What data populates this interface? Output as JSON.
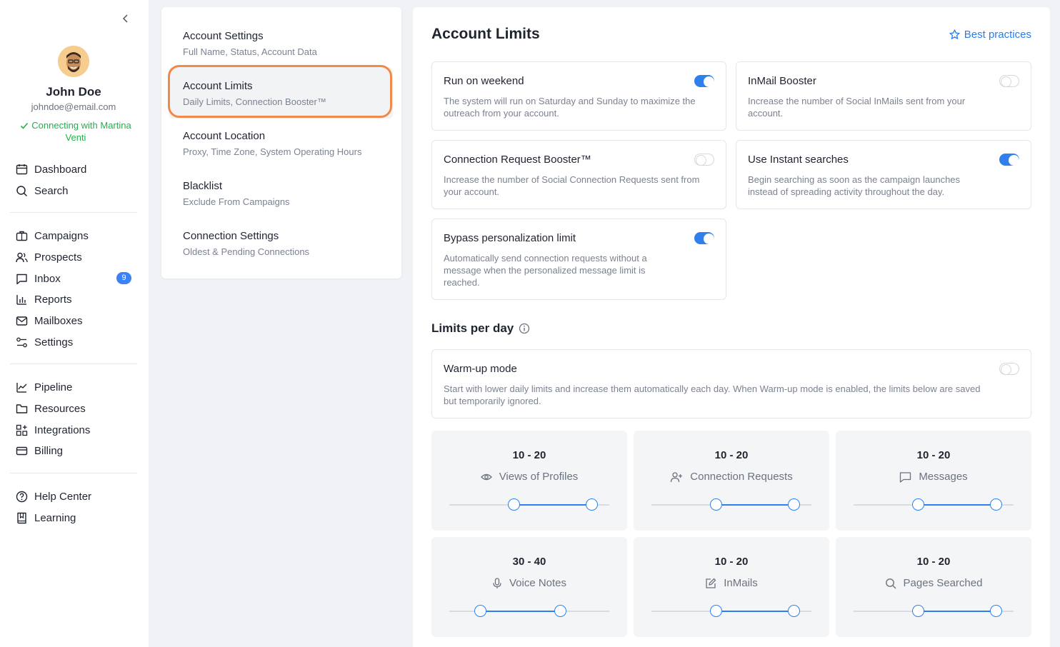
{
  "sidebar": {
    "user": {
      "name": "John Doe",
      "email": "johndoe@email.com",
      "status": "Connecting with Martina Venti"
    },
    "nav_group1": [
      {
        "label": "Dashboard",
        "icon": "calendar-icon"
      },
      {
        "label": "Search",
        "icon": "search-icon"
      }
    ],
    "nav_group2": [
      {
        "label": "Campaigns",
        "icon": "briefcase-icon"
      },
      {
        "label": "Prospects",
        "icon": "users-icon"
      },
      {
        "label": "Inbox",
        "icon": "chat-icon",
        "badge": "9"
      },
      {
        "label": "Reports",
        "icon": "bar-chart-icon"
      },
      {
        "label": "Mailboxes",
        "icon": "mail-icon"
      },
      {
        "label": "Settings",
        "icon": "sliders-icon"
      }
    ],
    "nav_group3": [
      {
        "label": "Pipeline",
        "icon": "line-chart-icon"
      },
      {
        "label": "Resources",
        "icon": "folder-icon"
      },
      {
        "label": "Integrations",
        "icon": "grid-plus-icon"
      },
      {
        "label": "Billing",
        "icon": "credit-card-icon"
      }
    ],
    "nav_group4": [
      {
        "label": "Help Center",
        "icon": "help-circle-icon"
      },
      {
        "label": "Learning",
        "icon": "book-icon"
      }
    ]
  },
  "settings_menu": [
    {
      "title": "Account Settings",
      "subtitle": "Full Name, Status, Account Data"
    },
    {
      "title": "Account Limits",
      "subtitle": "Daily Limits, Connection Booster™",
      "active": true
    },
    {
      "title": "Account Location",
      "subtitle": "Proxy, Time Zone, System Operating Hours"
    },
    {
      "title": "Blacklist",
      "subtitle": "Exclude From Campaigns"
    },
    {
      "title": "Connection Settings",
      "subtitle": "Oldest & Pending Connections"
    }
  ],
  "main": {
    "title": "Account Limits",
    "best_practices": "Best practices",
    "options": [
      {
        "title": "Run on weekend",
        "desc": "The system will run on Saturday and Sunday to maximize the outreach from your account.",
        "on": true
      },
      {
        "title": "InMail Booster",
        "desc": "Increase the number of Social InMails sent from your account.",
        "on": false
      },
      {
        "title": "Connection Request Booster™",
        "desc": "Increase the number of Social Connection Requests sent from your account.",
        "on": false
      },
      {
        "title": "Use Instant searches",
        "desc": "Begin searching as soon as the campaign launches instead of spreading activity throughout the day.",
        "on": true
      },
      {
        "title": "Bypass personalization limit",
        "desc": "Automatically send connection requests without a message when the personalized message limit is reached.",
        "on": true
      }
    ],
    "limits_title": "Limits per day",
    "warmup": {
      "title": "Warm-up mode",
      "desc": "Start with lower daily limits and increase them automatically each day. When Warm-up mode is enabled, the limits below are saved but temporarily ignored.",
      "on": false
    },
    "limits": [
      {
        "range": "10 - 20",
        "label": "Views of Profiles",
        "icon": "eye-icon",
        "low_fraction": 0.4,
        "high_fraction": 0.89
      },
      {
        "range": "10 - 20",
        "label": "Connection Requests",
        "icon": "user-plus-icon",
        "low_fraction": 0.4,
        "high_fraction": 0.89
      },
      {
        "range": "10 - 20",
        "label": "Messages",
        "icon": "message-icon",
        "low_fraction": 0.4,
        "high_fraction": 0.89
      },
      {
        "range": "30 - 40",
        "label": "Voice Notes",
        "icon": "microphone-icon",
        "low_fraction": 0.19,
        "high_fraction": 0.69
      },
      {
        "range": "10 - 20",
        "label": "InMails",
        "icon": "edit-icon",
        "low_fraction": 0.4,
        "high_fraction": 0.89
      },
      {
        "range": "10 - 20",
        "label": "Pages Searched",
        "icon": "search-icon",
        "low_fraction": 0.4,
        "high_fraction": 0.89
      }
    ]
  },
  "colors": {
    "accent": "#2f80ed",
    "success": "#22b04b",
    "highlight": "#f08a4b"
  }
}
